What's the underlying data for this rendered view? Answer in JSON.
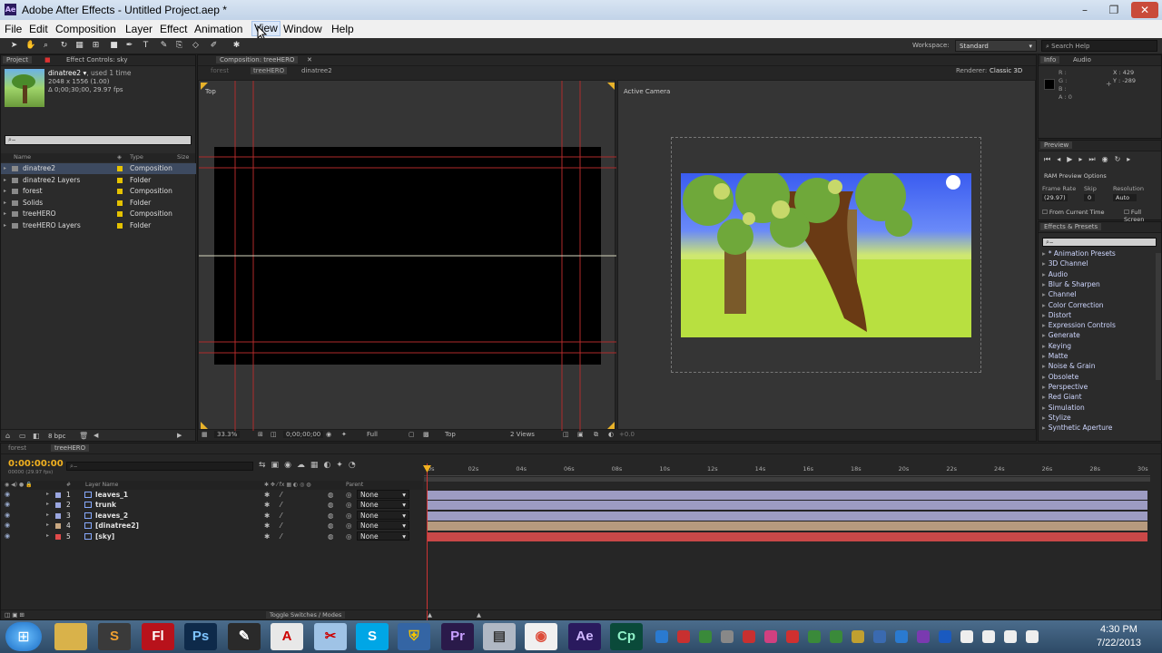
{
  "window": {
    "title": "Adobe After Effects - Untitled Project.aep *",
    "app_icon": "Ae"
  },
  "menu": [
    "File",
    "Edit",
    "Composition",
    "Layer",
    "Effect",
    "Animation",
    "View",
    "Window",
    "Help"
  ],
  "workspace": {
    "label": "Workspace:",
    "value": "Standard",
    "search_placeholder": "Search Help"
  },
  "project": {
    "tab_project": "Project",
    "tab_effect_controls": "Effect Controls: sky",
    "thumb_name": "dinatree2 ▾",
    "thumb_used": ", used 1 time",
    "thumb_dims": "2048 x 1556 (1.00)",
    "thumb_duration": "Δ 0;00;30;00, 29.97 fps",
    "col_name": "Name",
    "col_type": "Type",
    "col_size": "Size",
    "items": [
      {
        "name": "dinatree2",
        "type": "Composition",
        "selected": true
      },
      {
        "name": "dinatree2 Layers",
        "type": "Folder",
        "selected": false
      },
      {
        "name": "forest",
        "type": "Composition",
        "selected": false
      },
      {
        "name": "Solids",
        "type": "Folder",
        "selected": false
      },
      {
        "name": "treeHERO",
        "type": "Composition",
        "selected": false
      },
      {
        "name": "treeHERO Layers",
        "type": "Folder",
        "selected": false
      }
    ],
    "bpc": "8 bpc"
  },
  "composition": {
    "tab": "Composition: treeHERO",
    "crumb_forest": "forest",
    "crumb_tree": "treeHERO",
    "crumb_dina": "dinatree2",
    "renderer_label": "Renderer:",
    "renderer_value": "Classic 3D",
    "left_view": "Top",
    "right_view": "Active Camera",
    "zoom": "33.3%",
    "timecode": "0;00;00;00",
    "resolution": "Full",
    "view_select": "Top",
    "views_select": "2 Views",
    "exposure": "+0.0"
  },
  "info": {
    "tab_info": "Info",
    "tab_audio": "Audio",
    "r": "R :",
    "g": "G :",
    "b": "B :",
    "a": "A : 0",
    "x": "X : 429",
    "y": "Y : -289"
  },
  "preview": {
    "tab": "Preview",
    "ram_options": "RAM Preview Options",
    "frame_rate_label": "Frame Rate",
    "skip_label": "Skip",
    "resolution_label": "Resolution",
    "frame_rate": "(29.97)",
    "skip": "0",
    "resolution": "Auto",
    "from_current": "From Current Time",
    "full_screen": "Full Screen"
  },
  "effects": {
    "tab": "Effects & Presets",
    "items": [
      "* Animation Presets",
      "3D Channel",
      "Audio",
      "Blur & Sharpen",
      "Channel",
      "Color Correction",
      "Distort",
      "Expression Controls",
      "Generate",
      "Keying",
      "Matte",
      "Noise & Grain",
      "Obsolete",
      "Perspective",
      "Red Giant",
      "Simulation",
      "Stylize",
      "Synthetic Aperture"
    ]
  },
  "timeline": {
    "tab_forest": "forest",
    "tab_tree": "treeHERO",
    "timecode": "0:00:00:00",
    "fps_note": "00000 (29.97 fps)",
    "col_layer_name": "Layer Name",
    "col_parent": "Parent",
    "ruler": [
      "0s",
      "02s",
      "04s",
      "06s",
      "08s",
      "10s",
      "12s",
      "14s",
      "16s",
      "18s",
      "20s",
      "22s",
      "24s",
      "26s",
      "28s",
      "30s"
    ],
    "layers": [
      {
        "num": "1",
        "name": "leaves_1",
        "parent": "None",
        "label_color": "#9aa6e0",
        "bar_color": "#9d9cc2"
      },
      {
        "num": "2",
        "name": "trunk",
        "parent": "None",
        "label_color": "#9aa6e0",
        "bar_color": "#9d9cc2"
      },
      {
        "num": "3",
        "name": "leaves_2",
        "parent": "None",
        "label_color": "#9aa6e0",
        "bar_color": "#9d9cc2"
      },
      {
        "num": "4",
        "name": "[dinatree2]",
        "parent": "None",
        "label_color": "#c9a882",
        "bar_color": "#b69a7e"
      },
      {
        "num": "5",
        "name": "[sky]",
        "parent": "None",
        "label_color": "#e04a4a",
        "bar_color": "#c94848"
      }
    ],
    "toggle_label": "Toggle Switches / Modes"
  },
  "taskbar": {
    "apps": [
      {
        "name": "windows-explorer",
        "glyph": "",
        "bg": "#d9b24a",
        "fg": "#000"
      },
      {
        "name": "sublime",
        "glyph": "S",
        "bg": "#3a3a3a",
        "fg": "#f0a030"
      },
      {
        "name": "flash",
        "glyph": "Fl",
        "bg": "#b8121b",
        "fg": "#fff"
      },
      {
        "name": "photoshop",
        "glyph": "Ps",
        "bg": "#0e2a4a",
        "fg": "#7ec4ff"
      },
      {
        "name": "inkscape",
        "glyph": "✎",
        "bg": "#2a2a2a",
        "fg": "#fff"
      },
      {
        "name": "acrobat",
        "glyph": "A",
        "bg": "#e8e8e8",
        "fg": "#c00"
      },
      {
        "name": "snipping",
        "glyph": "✂",
        "bg": "#9fc3e6",
        "fg": "#c00"
      },
      {
        "name": "skype",
        "glyph": "S",
        "bg": "#00a6e6",
        "fg": "#fff"
      },
      {
        "name": "security",
        "glyph": "⛨",
        "bg": "#3465a4",
        "fg": "#f5c400"
      },
      {
        "name": "premiere",
        "glyph": "Pr",
        "bg": "#2a1a4a",
        "fg": "#c8a0ff"
      },
      {
        "name": "folder",
        "glyph": "▤",
        "bg": "#b0b8c4",
        "fg": "#333"
      },
      {
        "name": "chrome",
        "glyph": "◉",
        "bg": "#f0f0f0",
        "fg": "#dd4b39"
      },
      {
        "name": "after-effects",
        "glyph": "Ae",
        "bg": "#2a1a5e",
        "fg": "#d0b8ff"
      },
      {
        "name": "captivate",
        "glyph": "Cp",
        "bg": "#0a4a3a",
        "fg": "#8ff0c8"
      }
    ],
    "clock_time": "4:30 PM",
    "clock_date": "7/22/2013"
  }
}
